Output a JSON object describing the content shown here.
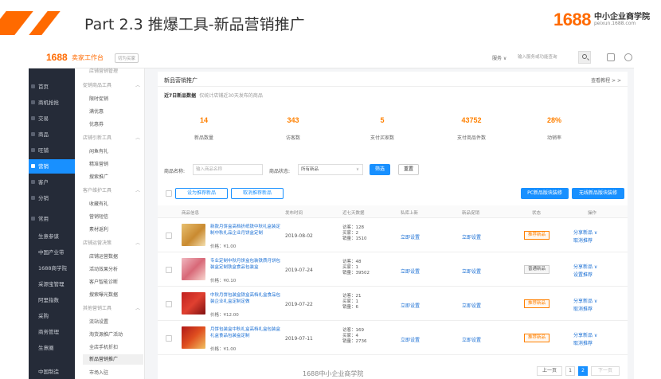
{
  "slide": {
    "title": "Part 2.3 推爆工具-新品营销推广",
    "brand_number": "1688",
    "brand_text": "中小企业商学院",
    "brand_url": "peixun.1688.com",
    "footer": "1688中小企业商学院"
  },
  "topbar": {
    "logo": "1688",
    "subtitle": "卖家工作台",
    "tag": "切为买家",
    "search_type": "服务 ∨",
    "search_placeholder": "输入服务或功能查询",
    "search_icon": "search-icon"
  },
  "nav": {
    "items": [
      {
        "label": "首页",
        "active": false
      },
      {
        "label": "商机抢抢",
        "active": false
      },
      {
        "label": "交易",
        "active": false
      },
      {
        "label": "商品",
        "active": false
      },
      {
        "label": "旺铺",
        "active": false
      },
      {
        "label": "营销",
        "active": true
      },
      {
        "label": "客户",
        "active": false
      },
      {
        "label": "分销",
        "active": false
      },
      {
        "label": "常用",
        "active": false
      },
      {
        "label": "生意参谋",
        "active": false
      },
      {
        "label": "中国产业带",
        "active": false
      },
      {
        "label": "1688商学院",
        "active": false
      },
      {
        "label": "采源宝管理",
        "active": false
      },
      {
        "label": "阿里指数",
        "active": false
      },
      {
        "label": "采购",
        "active": false
      },
      {
        "label": "商务管理",
        "active": false
      },
      {
        "label": "生意圈",
        "active": false
      },
      {
        "label": "中国制造",
        "active": false
      }
    ]
  },
  "submenu": {
    "top_item": "店铺营销管理",
    "groups": [
      {
        "title": "促销商品工具",
        "items": [
          "限时促销",
          "满优惠",
          "优惠券"
        ]
      },
      {
        "title": "店铺引新工具",
        "items": [
          "闲鱼有礼",
          "精准营销",
          "搜索推广"
        ]
      },
      {
        "title": "客户维护工具",
        "items": [
          "收藏有礼",
          "营销短信",
          "素材返利"
        ]
      },
      {
        "title": "店铺运营决策",
        "items": [
          "店铺运营数据",
          "活动效果分析",
          "客户智能诊断",
          "搜索曝光数据"
        ]
      },
      {
        "title": "其他营销工具",
        "items": [
          "流站设置",
          "淘货源推广活动",
          "全店手机折扣",
          "新品营销推广",
          "市场入驻"
        ]
      }
    ],
    "active_item": "新品营销推广"
  },
  "main": {
    "title": "新品营销推广",
    "help": "查看教程 > >",
    "stat_head": "近7日新品数据",
    "stat_note": "仅统计店铺近30天发布的商品",
    "stats": [
      {
        "value": "14",
        "label": "新品数量"
      },
      {
        "value": "343",
        "label": "访客数"
      },
      {
        "value": "5",
        "label": "支付买家数"
      },
      {
        "value": "43752",
        "label": "支付商品件数"
      },
      {
        "value": "28%",
        "label": "动销率"
      }
    ],
    "filter": {
      "name_label": "商品名称:",
      "name_placeholder": "输入商品名称",
      "status_label": "商品状态:",
      "status_value": "所有新品",
      "search_btn": "筛选",
      "reset_btn": "重置"
    },
    "actions": {
      "set_btn": "设为推荐新品",
      "cancel_btn": "取消推荐新品",
      "pc_btn": "PC新品版块装修",
      "wireless_btn": "无线新品版块装修"
    },
    "table_headers": [
      "商品信息",
      "发布时间",
      "近七天数据",
      "私库上新",
      "新品促销",
      "状态",
      "操作"
    ],
    "rows": [
      {
        "name": "新款月饼盒高档折纸铁中秋礼盒装定制中秋礼品企业月饼盒定制",
        "price": "价格：¥1.00",
        "date": "2019-08-02",
        "stats": [
          "访客：128",
          "买家：2",
          "销量：1510"
        ],
        "link1": "立即设置",
        "link2": "立即设置",
        "status": "推荐新品",
        "op1": "分享新品 ∨",
        "op2": "取消推荐"
      },
      {
        "name": "专业定制中秋月饼盒包装铁质月饼包装盒定制铁盒食品包装盒",
        "price": "价格：¥0.10",
        "date": "2019-07-24",
        "stats": [
          "访客：48",
          "买家：1",
          "销量：39502"
        ],
        "link1": "立即设置",
        "link2": "立即设置",
        "status": "普通新品",
        "op1": "分享新品 ∨",
        "op2": "设置推荐"
      },
      {
        "name": "中秋月饼包装盒铁盒高档礼盒食品包装企业礼盒定制定做",
        "price": "价格：¥12.00",
        "date": "2019-07-22",
        "stats": [
          "访客：21",
          "买家：1",
          "销量：6"
        ],
        "link1": "立即设置",
        "link2": "立即设置",
        "status": "推荐新品",
        "op1": "分享新品 ∨",
        "op2": "取消推荐"
      },
      {
        "name": "月饼包装盒中秋礼盒高档礼盒包装盒礼盒食品包装盒定制",
        "price": "价格：¥1.00",
        "date": "2019-07-11",
        "stats": [
          "访客：169",
          "买家：4",
          "销量：2736"
        ],
        "link1": "立即设置",
        "link2": "立即设置",
        "status": "推荐新品",
        "op1": "分享新品 ∨",
        "op2": "取消推荐"
      }
    ],
    "pager": {
      "prev": "上一页",
      "p1": "1",
      "p2": "2",
      "next": "下一页"
    }
  },
  "colors": {
    "accent": "#ff6a00",
    "primary": "#1890ff",
    "nav_bg": "#252b38",
    "stat_value": "#ff8000"
  }
}
